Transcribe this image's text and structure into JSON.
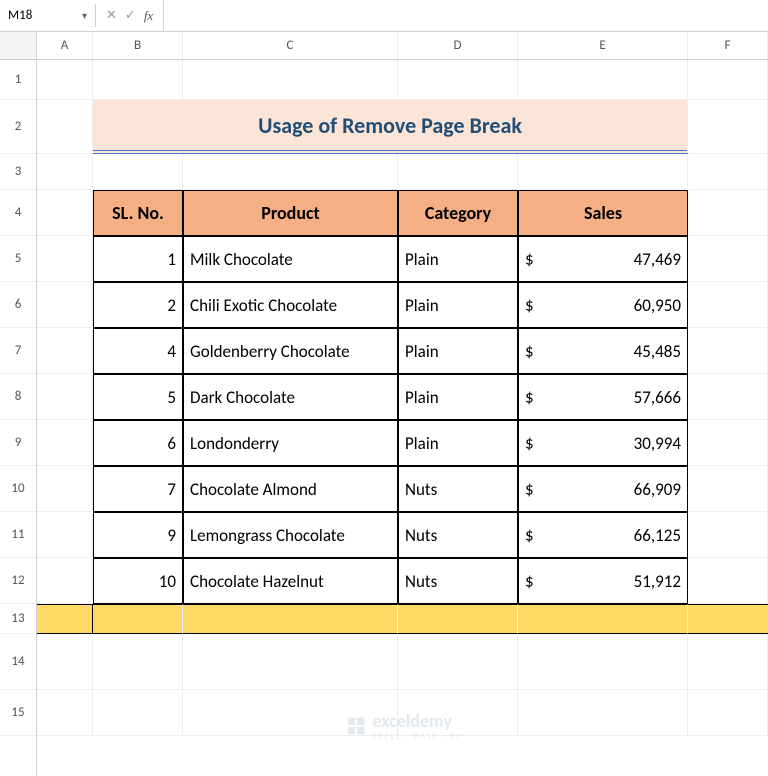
{
  "nameBox": {
    "value": "M18"
  },
  "formulaBar": {
    "value": ""
  },
  "colHeaders": [
    "A",
    "B",
    "C",
    "D",
    "E",
    "F"
  ],
  "rowHeaders": [
    "1",
    "2",
    "3",
    "4",
    "5",
    "6",
    "7",
    "8",
    "9",
    "10",
    "11",
    "12",
    "13",
    "14",
    "15"
  ],
  "title": "Usage of Remove Page Break",
  "tableHeaders": {
    "sl": "SL. No.",
    "product": "Product",
    "category": "Category",
    "sales": "Sales"
  },
  "rows": [
    {
      "sl": "1",
      "product": "Milk Chocolate",
      "category": "Plain",
      "currency": "$",
      "sales": "47,469"
    },
    {
      "sl": "2",
      "product": "Chili Exotic Chocolate",
      "category": "Plain",
      "currency": "$",
      "sales": "60,950"
    },
    {
      "sl": "4",
      "product": "Goldenberry Chocolate",
      "category": "Plain",
      "currency": "$",
      "sales": "45,485"
    },
    {
      "sl": "5",
      "product": "Dark Chocolate",
      "category": "Plain",
      "currency": "$",
      "sales": "57,666"
    },
    {
      "sl": "6",
      "product": "Londonderry",
      "category": "Plain",
      "currency": "$",
      "sales": "30,994"
    },
    {
      "sl": "7",
      "product": "Chocolate Almond",
      "category": "Nuts",
      "currency": "$",
      "sales": "66,909"
    },
    {
      "sl": "9",
      "product": "Lemongrass Chocolate",
      "category": "Nuts",
      "currency": "$",
      "sales": "66,125"
    },
    {
      "sl": "10",
      "product": "Chocolate Hazelnut",
      "category": "Nuts",
      "currency": "$",
      "sales": "51,912"
    }
  ],
  "watermark": {
    "brand": "exceldemy",
    "sub": "EXCEL · DATA · BI"
  },
  "chart_data": {
    "type": "table",
    "title": "Usage of Remove Page Break",
    "columns": [
      "SL. No.",
      "Product",
      "Category",
      "Sales"
    ],
    "data": [
      [
        1,
        "Milk Chocolate",
        "Plain",
        47469
      ],
      [
        2,
        "Chili Exotic Chocolate",
        "Plain",
        60950
      ],
      [
        4,
        "Goldenberry Chocolate",
        "Plain",
        45485
      ],
      [
        5,
        "Dark Chocolate",
        "Plain",
        57666
      ],
      [
        6,
        "Londonderry",
        "Plain",
        30994
      ],
      [
        7,
        "Chocolate Almond",
        "Nuts",
        66909
      ],
      [
        9,
        "Lemongrass Chocolate",
        "Nuts",
        66125
      ],
      [
        10,
        "Chocolate Hazelnut",
        "Nuts",
        51912
      ]
    ]
  }
}
